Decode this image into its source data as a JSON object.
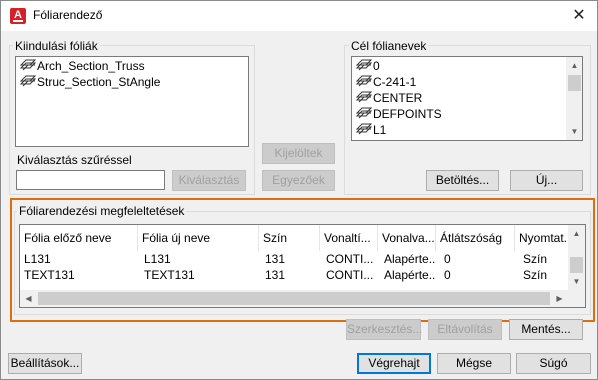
{
  "window": {
    "title": "Fóliarendező",
    "close_glyph": "✕"
  },
  "source": {
    "group_label": "Kiindulási fóliák",
    "items": [
      "Arch_Section_Truss",
      "Struc_Section_StAngle"
    ],
    "filter_label": "Kiválasztás szűréssel",
    "filter_value": "",
    "select_button": "Kiválasztás"
  },
  "middle": {
    "map_button": "Kijelöltek",
    "map_same_button": "Egyezőek"
  },
  "target": {
    "group_label": "Cél fólianevek",
    "items": [
      "0",
      "C-241-1",
      "CENTER",
      "DEFPOINTS",
      "L1"
    ],
    "load_button": "Betöltés...",
    "new_button": "Új..."
  },
  "mappings": {
    "group_label": "Fóliarendezési megfeleltetések",
    "columns": [
      "Fólia előző neve",
      "Fólia új neve",
      "Szín",
      "Vonaltí...",
      "Vonalva...",
      "Átlátszóság",
      "Nyomtat..."
    ],
    "rows": [
      [
        "L131",
        "L131",
        "131",
        "CONTI...",
        "Alapérte...",
        "0",
        "Szín"
      ],
      [
        "TEXT131",
        "TEXT131",
        "131",
        "CONTI...",
        "Alapérte...",
        "0",
        "Szín"
      ]
    ],
    "edit_button": "Szerkesztés...",
    "remove_button": "Eltávolítás",
    "save_button": "Mentés..."
  },
  "footer": {
    "settings_button": "Beállítások...",
    "apply_button": "Végrehajt",
    "cancel_button": "Mégse",
    "help_button": "Súgó"
  },
  "colors": {
    "highlight_frame": "#e06c10",
    "app_icon": "#d3202a",
    "default_button_border": "#0078d7"
  },
  "icons": {
    "app": "autocad-logo-icon",
    "layer": "layer-stack-icon"
  }
}
